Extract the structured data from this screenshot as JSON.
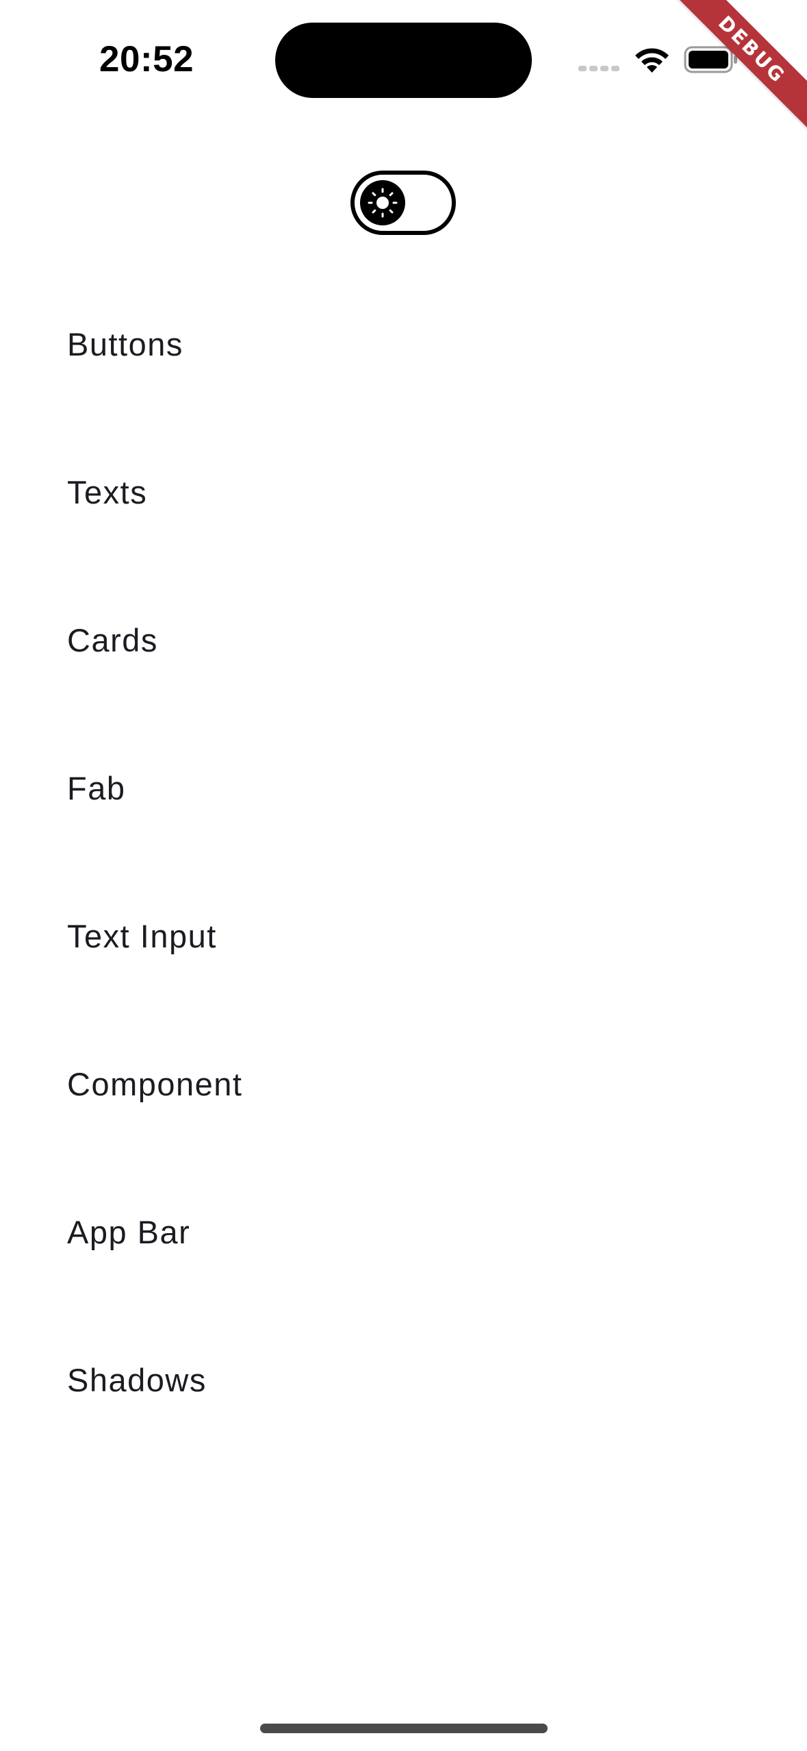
{
  "status_bar": {
    "time": "20:52",
    "signal_icon": "cellular-signal-icon",
    "wifi_icon": "wifi-icon",
    "battery_icon": "battery-icon"
  },
  "debug_banner": {
    "label": "DEBUG",
    "color": "#b5343a"
  },
  "theme_toggle": {
    "icon": "sun-icon",
    "state": "light"
  },
  "menu": {
    "items": [
      {
        "label": "Buttons"
      },
      {
        "label": "Texts"
      },
      {
        "label": "Cards"
      },
      {
        "label": "Fab"
      },
      {
        "label": "Text Input"
      },
      {
        "label": "Component"
      },
      {
        "label": "App Bar"
      },
      {
        "label": "Shadows"
      }
    ]
  }
}
